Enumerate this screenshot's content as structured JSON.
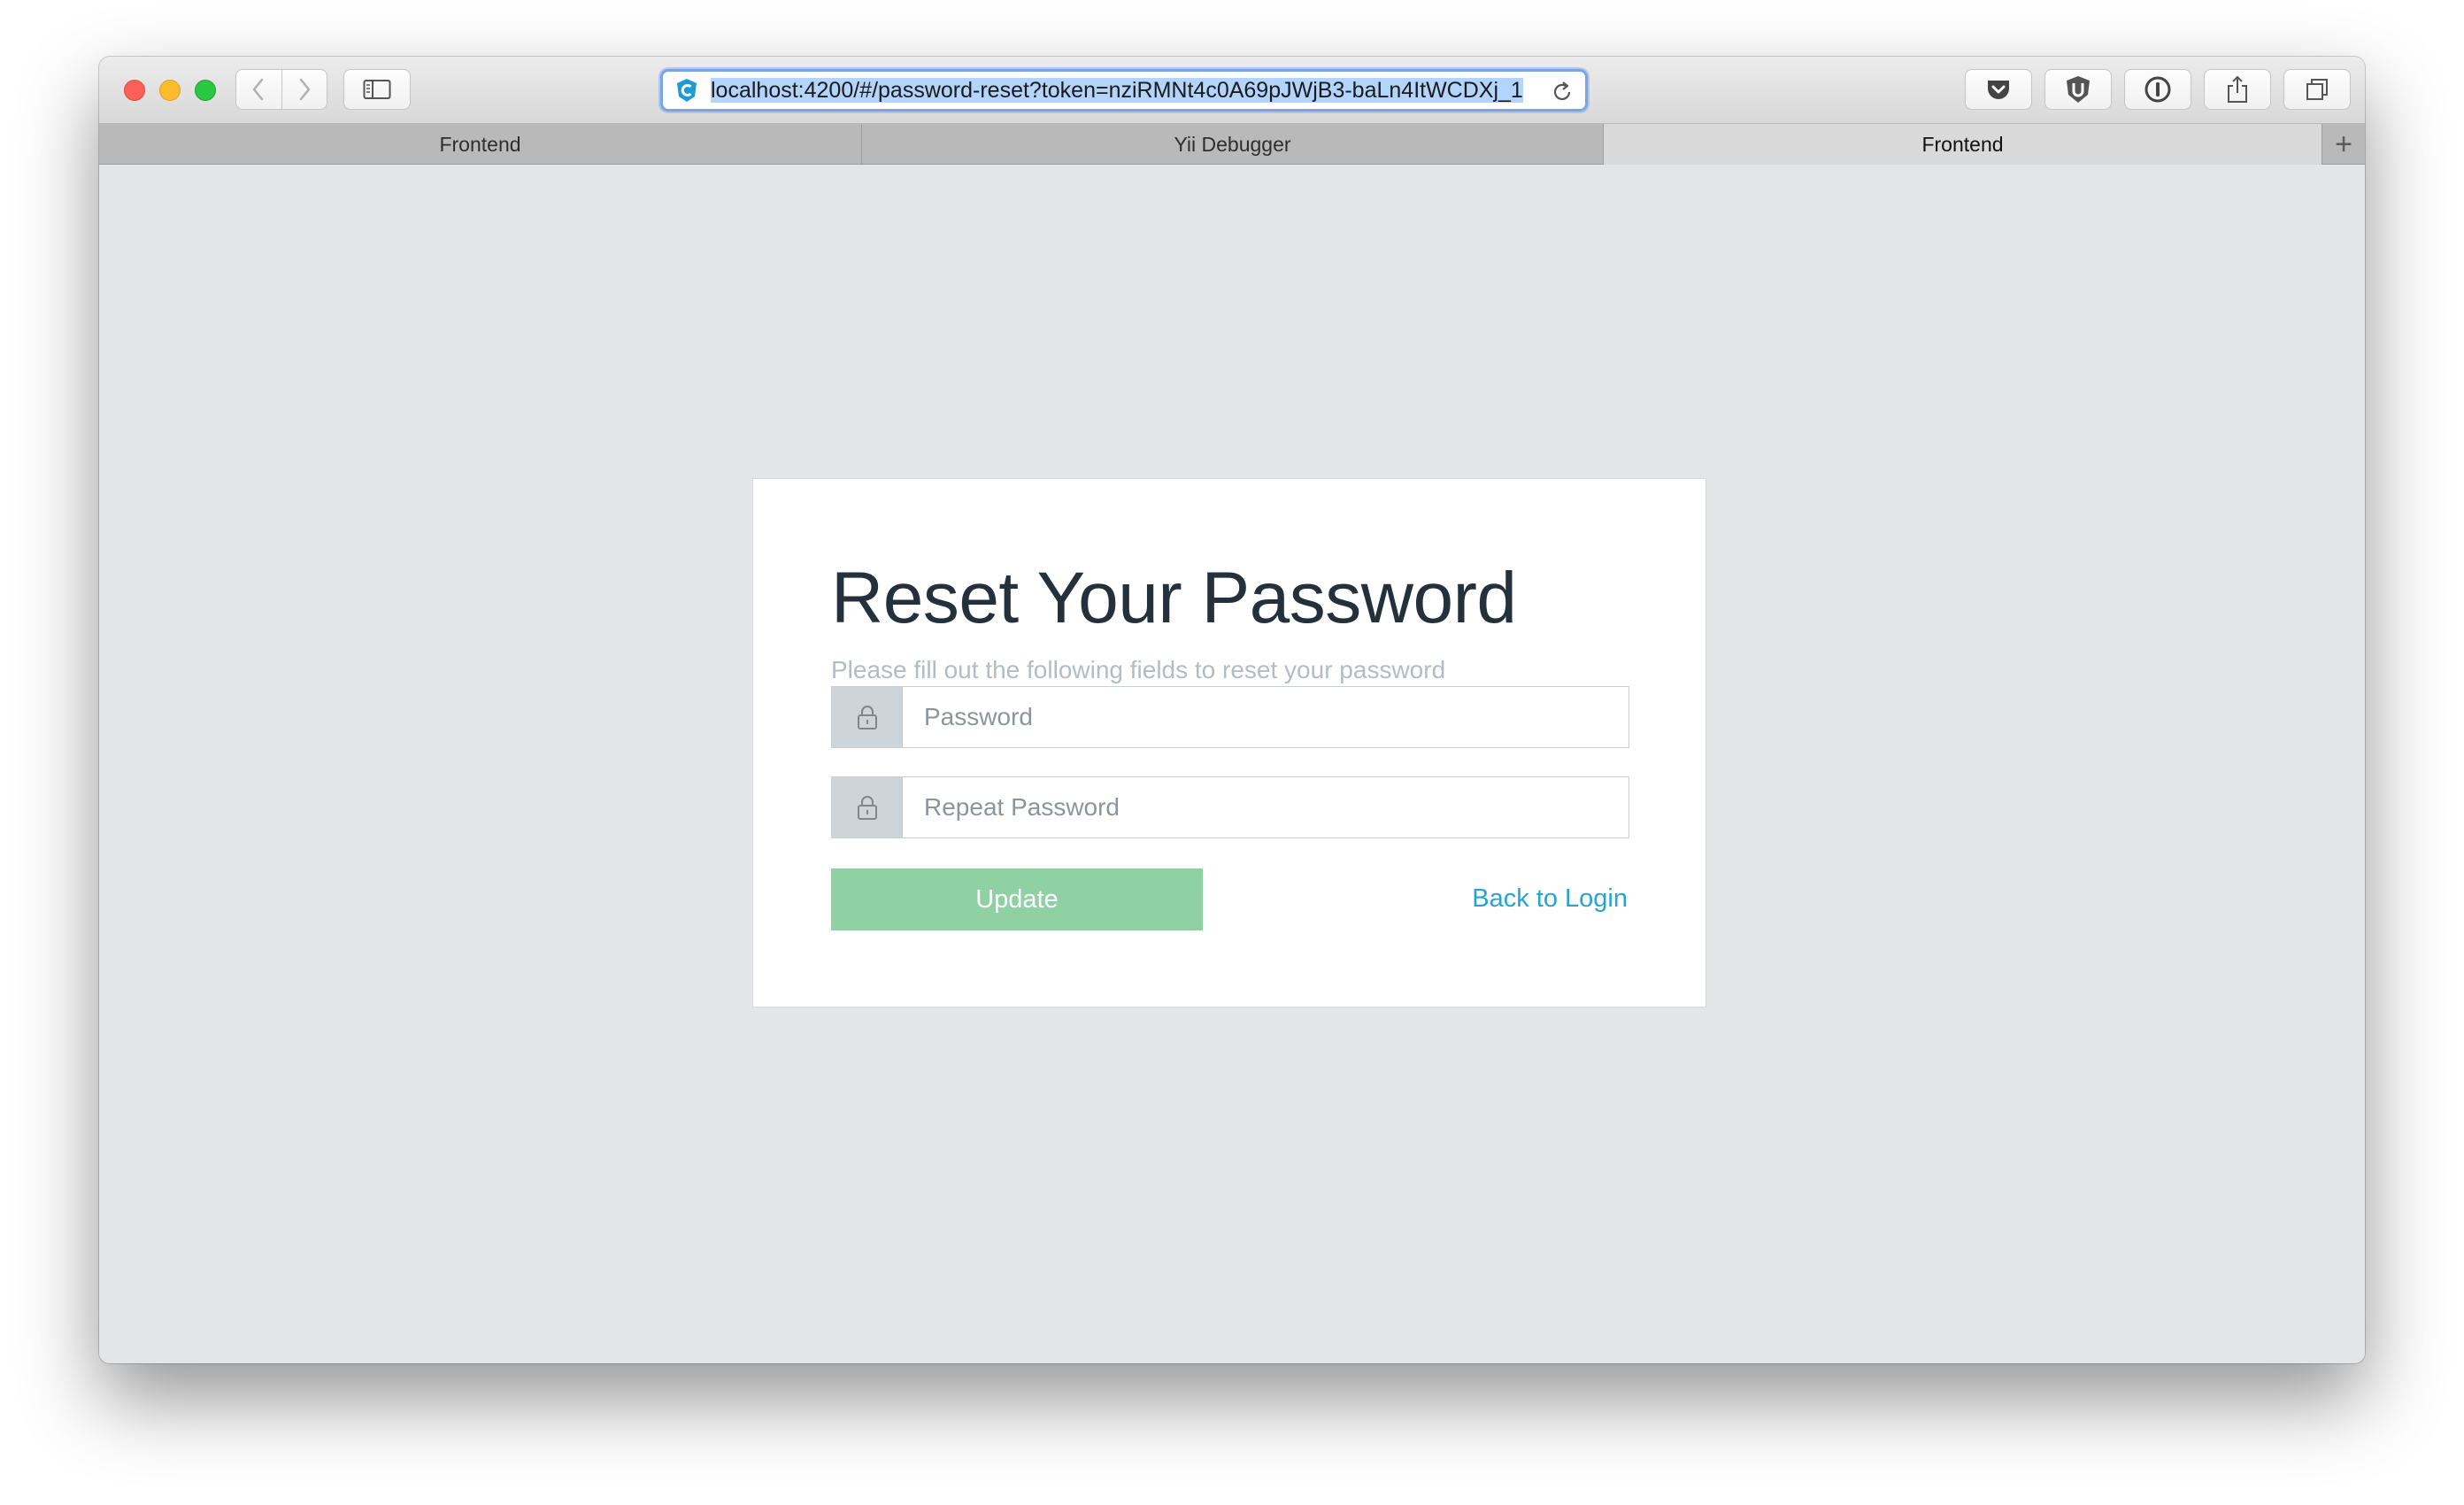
{
  "browser": {
    "url": "localhost:4200/#/password-reset?token=nziRMNt4c0A69pJWjB3-baLn4ItWCDXj_1",
    "tabs": [
      {
        "label": "Frontend",
        "active": false
      },
      {
        "label": "Yii Debugger",
        "active": false
      },
      {
        "label": "Frontend",
        "active": true
      }
    ],
    "new_tab_label": "+"
  },
  "page": {
    "title": "Reset Your Password",
    "subtitle": "Please fill out the following fields to reset your password",
    "fields": [
      {
        "placeholder": "Password",
        "icon": "lock-icon",
        "value": ""
      },
      {
        "placeholder": "Repeat Password",
        "icon": "lock-icon",
        "value": ""
      }
    ],
    "submit_label": "Update",
    "back_link_label": "Back to Login"
  },
  "colors": {
    "background": "#e4e5e7",
    "card": "#ffffff",
    "button": "#8fd1a3",
    "link": "#27a4cf",
    "title": "#24303a",
    "subtitle": "#b3bcc3",
    "addon": "#cdd5db"
  }
}
